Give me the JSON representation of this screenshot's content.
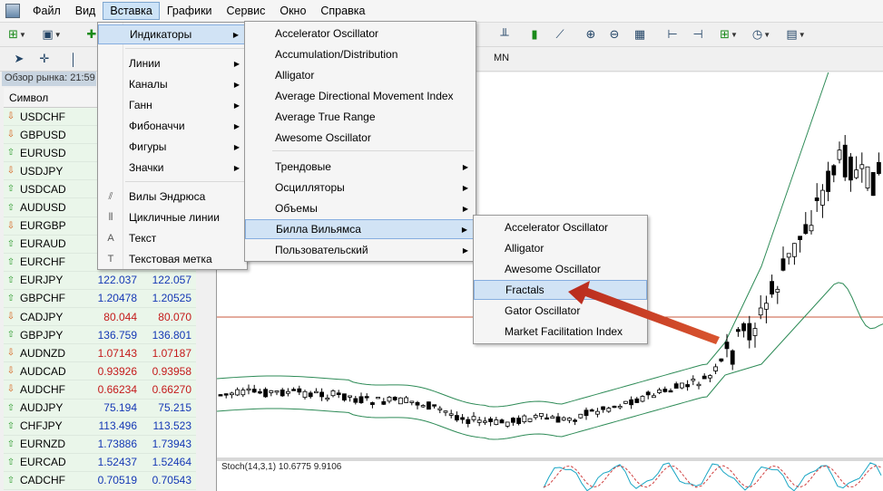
{
  "menubar": {
    "items": [
      "Файл",
      "Вид",
      "Вставка",
      "Графики",
      "Сервис",
      "Окно",
      "Справка"
    ],
    "active_index": 2
  },
  "timeframe": {
    "mn_label": "MN"
  },
  "market_watch": {
    "header": "Обзор рынка: 21:59",
    "col_symbol": "Символ",
    "rows": [
      {
        "symbol": "USDCHF",
        "dir": "down",
        "bid": "",
        "ask": ""
      },
      {
        "symbol": "GBPUSD",
        "dir": "down",
        "bid": "",
        "ask": ""
      },
      {
        "symbol": "EURUSD",
        "dir": "up",
        "bid": "",
        "ask": ""
      },
      {
        "symbol": "USDJPY",
        "dir": "down",
        "bid": "",
        "ask": ""
      },
      {
        "symbol": "USDCAD",
        "dir": "up",
        "bid": "",
        "ask": ""
      },
      {
        "symbol": "AUDUSD",
        "dir": "up",
        "bid": "",
        "ask": ""
      },
      {
        "symbol": "EURGBP",
        "dir": "down",
        "bid": "",
        "ask": ""
      },
      {
        "symbol": "EURAUD",
        "dir": "up",
        "bid": "",
        "ask": ""
      },
      {
        "symbol": "EURCHF",
        "dir": "up",
        "bid": "",
        "ask": ""
      },
      {
        "symbol": "EURJPY",
        "dir": "up",
        "bid": "122.037",
        "ask": "122.057",
        "color": "blue"
      },
      {
        "symbol": "GBPCHF",
        "dir": "up",
        "bid": "1.20478",
        "ask": "1.20525",
        "color": "blue"
      },
      {
        "symbol": "CADJPY",
        "dir": "down",
        "bid": "80.044",
        "ask": "80.070",
        "color": "red"
      },
      {
        "symbol": "GBPJPY",
        "dir": "up",
        "bid": "136.759",
        "ask": "136.801",
        "color": "blue"
      },
      {
        "symbol": "AUDNZD",
        "dir": "down",
        "bid": "1.07143",
        "ask": "1.07187",
        "color": "red"
      },
      {
        "symbol": "AUDCAD",
        "dir": "down",
        "bid": "0.93926",
        "ask": "0.93958",
        "color": "red"
      },
      {
        "symbol": "AUDCHF",
        "dir": "down",
        "bid": "0.66234",
        "ask": "0.66270",
        "color": "red"
      },
      {
        "symbol": "AUDJPY",
        "dir": "up",
        "bid": "75.194",
        "ask": "75.215",
        "color": "blue"
      },
      {
        "symbol": "CHFJPY",
        "dir": "up",
        "bid": "113.496",
        "ask": "113.523",
        "color": "blue"
      },
      {
        "symbol": "EURNZD",
        "dir": "up",
        "bid": "1.73886",
        "ask": "1.73943",
        "color": "blue"
      },
      {
        "symbol": "EURCAD",
        "dir": "up",
        "bid": "1.52437",
        "ask": "1.52464",
        "color": "blue"
      },
      {
        "symbol": "CADCHF",
        "dir": "up",
        "bid": "0.70519",
        "ask": "0.70543",
        "color": "blue"
      }
    ]
  },
  "insert_menu": {
    "items": [
      {
        "label": "Индикаторы",
        "submenu": true,
        "icon": ""
      },
      {
        "label": "Линии",
        "submenu": true,
        "icon": ""
      },
      {
        "label": "Каналы",
        "submenu": true,
        "icon": ""
      },
      {
        "label": "Ганн",
        "submenu": true,
        "icon": ""
      },
      {
        "label": "Фибоначчи",
        "submenu": true,
        "icon": ""
      },
      {
        "label": "Фигуры",
        "submenu": true,
        "icon": ""
      },
      {
        "label": "Значки",
        "submenu": true,
        "icon": ""
      },
      {
        "label": "Вилы Эндрюса",
        "submenu": false,
        "icon": "pitchfork-icon"
      },
      {
        "label": "Цикличные линии",
        "submenu": false,
        "icon": "cycle-lines-icon"
      },
      {
        "label": "Текст",
        "submenu": false,
        "icon": "text-icon"
      },
      {
        "label": "Текстовая метка",
        "submenu": false,
        "icon": "text-label-icon"
      }
    ]
  },
  "indicators_menu": {
    "items": [
      {
        "label": "Accelerator Oscillator",
        "submenu": false
      },
      {
        "label": "Accumulation/Distribution",
        "submenu": false
      },
      {
        "label": "Alligator",
        "submenu": false
      },
      {
        "label": "Average Directional Movement Index",
        "submenu": false
      },
      {
        "label": "Average True Range",
        "submenu": false
      },
      {
        "label": "Awesome Oscillator",
        "submenu": false
      },
      {
        "label": "Трендовые",
        "submenu": true
      },
      {
        "label": "Осцилляторы",
        "submenu": true
      },
      {
        "label": "Объемы",
        "submenu": true
      },
      {
        "label": "Билла Вильямса",
        "submenu": true
      },
      {
        "label": "Пользовательский",
        "submenu": true
      }
    ]
  },
  "williams_menu": {
    "items": [
      {
        "label": "Accelerator Oscillator"
      },
      {
        "label": "Alligator"
      },
      {
        "label": "Awesome Oscillator"
      },
      {
        "label": "Fractals"
      },
      {
        "label": "Gator Oscillator"
      },
      {
        "label": "Market Facilitation Index"
      }
    ]
  },
  "chart": {
    "stoch_label": "Stoch(14,3,1) 10.6775 9.9106"
  },
  "colors": {
    "menu_highlight": "#d1e3f5",
    "arrow": "#c0392b",
    "bollinger": "#2e8b57",
    "price_line": "#c85a3c"
  }
}
